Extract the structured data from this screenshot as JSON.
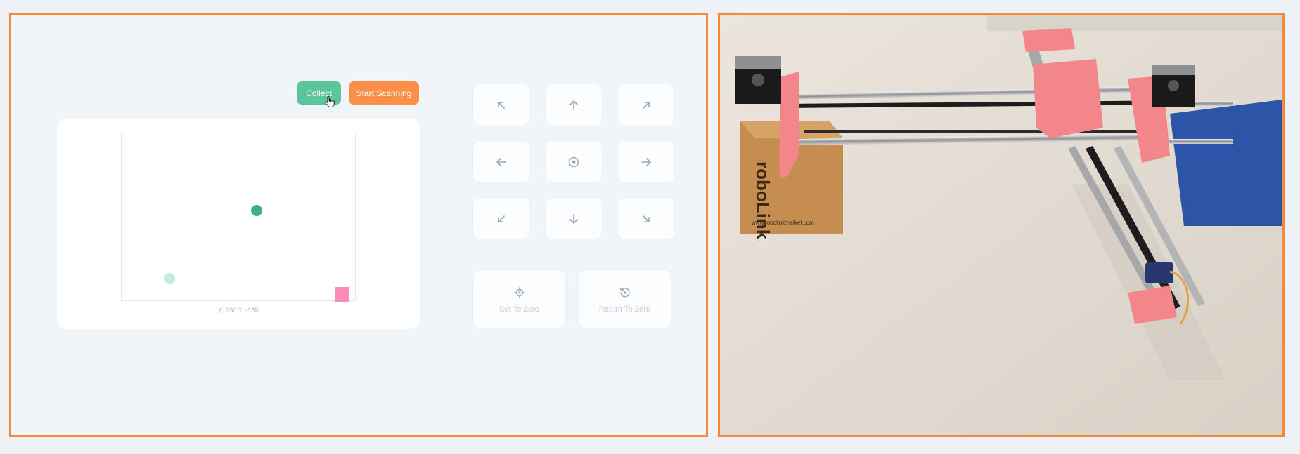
{
  "controls": {
    "collect_label": "Collect",
    "scan_label": "Start Scanning"
  },
  "position_plot": {
    "readout": "X: 250 Y: -185"
  },
  "jog_pad": {
    "buttons": [
      {
        "id": "up-left",
        "icon": "arrow-up-left-icon"
      },
      {
        "id": "up",
        "icon": "arrow-up-icon"
      },
      {
        "id": "up-right",
        "icon": "arrow-up-right-icon"
      },
      {
        "id": "left",
        "icon": "arrow-left-icon"
      },
      {
        "id": "center",
        "icon": "target-icon"
      },
      {
        "id": "right",
        "icon": "arrow-right-icon"
      },
      {
        "id": "down-left",
        "icon": "arrow-down-left-icon"
      },
      {
        "id": "down",
        "icon": "arrow-down-icon"
      },
      {
        "id": "down-right",
        "icon": "arrow-down-right-icon"
      }
    ]
  },
  "zero_controls": {
    "set_zero_label": "Set To Zero",
    "return_zero_label": "Return To Zero"
  },
  "camera": {
    "box_text": "roboLink",
    "box_url": "www.robolinkmarket.com"
  },
  "colors": {
    "frame_border": "#f38a3f",
    "collect": "#5cc59b",
    "scan": "#fc8f48",
    "current_position": "#3fae8a",
    "origin": "#c1ece0",
    "target": "#ff8cb6",
    "printed_parts": "#f2868a"
  }
}
